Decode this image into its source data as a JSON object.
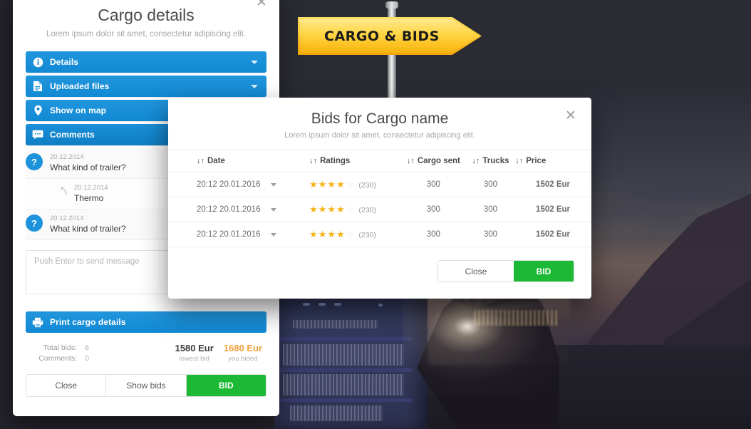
{
  "scene": {
    "sign_label": "CARGO & BIDS"
  },
  "cargo_panel": {
    "title": "Cargo details",
    "subtitle": "Lorem ipsum dolor sit amet, consectetur adipiscing elit.",
    "close_icon": "✕",
    "accordion": [
      {
        "label": "Details",
        "icon": "info-icon",
        "has_caret": true
      },
      {
        "label": "Uploaded files",
        "icon": "document-icon",
        "has_caret": true
      },
      {
        "label": "Show on map",
        "icon": "map-pin-icon",
        "has_caret": false
      },
      {
        "label": "Comments",
        "icon": "comment-bubble-icon",
        "has_caret": false
      }
    ],
    "comments": [
      {
        "avatar": "?",
        "date": "20.12.2014",
        "text": "What kind of trailer?",
        "reply": false
      },
      {
        "avatar": "",
        "date": "20.12.2014",
        "text": "Thermo",
        "reply": true
      },
      {
        "avatar": "?",
        "date": "20.12.2014",
        "text": "What kind of trailer?",
        "reply": false
      }
    ],
    "message_placeholder": "Push Enter to send message",
    "print_label": "Print cargo details",
    "totals": {
      "rows": [
        {
          "key": "Total bids:",
          "value": "6"
        },
        {
          "key": "Comments:",
          "value": "0"
        }
      ],
      "lowest": {
        "amount": "1580 Eur",
        "caption": "lowest bid"
      },
      "yours": {
        "amount": "1680 Eur",
        "caption": "you bided"
      }
    },
    "buttons": [
      {
        "label": "Close",
        "style": "plain"
      },
      {
        "label": "Show bids",
        "style": "plain"
      },
      {
        "label": "BID",
        "style": "green"
      }
    ]
  },
  "bids_modal": {
    "title": "Bids for Cargo name",
    "subtitle": "Lorem ipsum dolor sit amet, consectetur adipiscing elit.",
    "close_icon": "✕",
    "sort_icon": "↓↑",
    "columns": [
      "Date",
      "Ratings",
      "Cargo sent",
      "Trucks",
      "Price"
    ],
    "rows": [
      {
        "date": "20:12 20.01.2016",
        "stars_filled": 4,
        "stars_total": 5,
        "rating_count": "(230)",
        "cargo_sent": "300",
        "trucks": "300",
        "price": "1502 Eur"
      },
      {
        "date": "20:12 20.01.2016",
        "stars_filled": 4,
        "stars_total": 5,
        "rating_count": "(230)",
        "cargo_sent": "300",
        "trucks": "300",
        "price": "1502 Eur"
      },
      {
        "date": "20:12 20.01.2016",
        "stars_filled": 4,
        "stars_total": 5,
        "rating_count": "(230)",
        "cargo_sent": "300",
        "trucks": "300",
        "price": "1502 Eur"
      }
    ],
    "buttons": [
      {
        "label": "Close",
        "style": "plain"
      },
      {
        "label": "BID",
        "style": "green"
      }
    ]
  },
  "colors": {
    "blue": "#1289d4",
    "green": "#1bb934",
    "star": "#f5b315",
    "orange": "#f2a23c",
    "sign_yellow": "#ffd84c"
  }
}
